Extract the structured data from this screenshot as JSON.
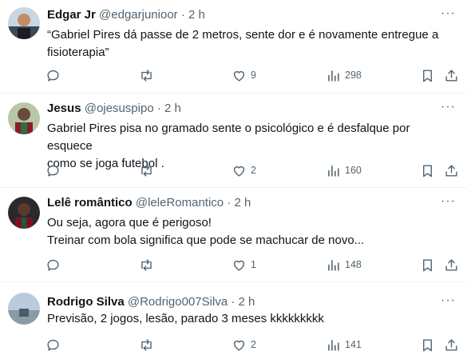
{
  "tweets": [
    {
      "name": "Edgar Jr",
      "handle": "@edgarjunioor",
      "dot": "·",
      "time": "2 h",
      "lines": [
        "“Gabriel Pires dá passe de 2 metros, sente dor e é novamente entregue a",
        "fisioterapia”"
      ],
      "likes": "9",
      "views": "298",
      "avatar_colors": [
        "#4a6b8a",
        "#1c1c22"
      ]
    },
    {
      "name": "Jesus",
      "handle": "@ojesuspipo",
      "dot": "·",
      "time": "2 h",
      "lines": [
        "Gabriel Pires pisa no gramado sente o psicológico e é desfalque por esquece",
        "como se joga futebol ."
      ],
      "likes": "2",
      "views": "160",
      "avatar_colors": [
        "#2e6f3e",
        "#8a1b2c"
      ]
    },
    {
      "name": "Lelê romântico",
      "handle": "@leleRomantico",
      "dot": "·",
      "time": "2 h",
      "lines": [
        "Ou seja, agora que é perigoso!",
        "Treinar com bola significa que pode se machucar de novo..."
      ],
      "likes": "1",
      "views": "148",
      "avatar_colors": [
        "#1a1a1a",
        "#7a1225"
      ]
    },
    {
      "name": "Rodrigo Silva",
      "handle": "@Rodrigo007Silva",
      "dot": "·",
      "time": "2 h",
      "lines": [
        "Previsão, 2 jogos, lesão, parado 3 meses kkkkkkkkk"
      ],
      "likes": "2",
      "views": "141",
      "avatar_colors": [
        "#9fb4c8",
        "#4b5a66"
      ]
    }
  ],
  "more_label": "···",
  "icons": {
    "reply": "reply-icon",
    "retweet": "retweet-icon",
    "like": "heart-icon",
    "views": "views-icon",
    "bookmark": "bookmark-icon",
    "share": "share-icon",
    "more": "more-icon"
  }
}
